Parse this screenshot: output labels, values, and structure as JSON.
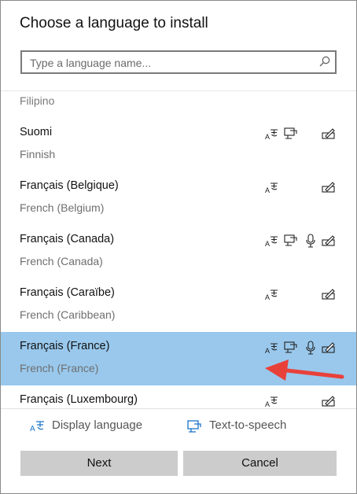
{
  "dialog": {
    "title": "Choose a language to install",
    "search": {
      "placeholder": "Type a language name...",
      "value": ""
    }
  },
  "list": {
    "partial_item": "Filipino",
    "items": [
      {
        "native": "Suomi",
        "english": "Finnish",
        "features": [
          "display-language-icon",
          "text-to-speech-icon",
          "handwriting-icon"
        ],
        "selected": false
      },
      {
        "native": "Français (Belgique)",
        "english": "French (Belgium)",
        "features": [
          "display-language-icon",
          "handwriting-icon"
        ],
        "selected": false
      },
      {
        "native": "Français (Canada)",
        "english": "French (Canada)",
        "features": [
          "display-language-icon",
          "text-to-speech-icon",
          "speech-recognition-icon",
          "handwriting-icon"
        ],
        "selected": false
      },
      {
        "native": "Français (Caraïbe)",
        "english": "French (Caribbean)",
        "features": [
          "display-language-icon",
          "handwriting-icon"
        ],
        "selected": false
      },
      {
        "native": "Français (France)",
        "english": "French (France)",
        "features": [
          "display-language-icon",
          "text-to-speech-icon",
          "speech-recognition-icon",
          "handwriting-icon"
        ],
        "selected": true
      },
      {
        "native": "Français (Luxembourg)",
        "english": "",
        "features": [
          "display-language-icon",
          "handwriting-icon"
        ],
        "selected": false
      }
    ]
  },
  "legend": {
    "display_language": "Display language",
    "text_to_speech": "Text-to-speech"
  },
  "buttons": {
    "next": "Next",
    "cancel": "Cancel"
  },
  "colors": {
    "selected_bg": "#99c8ec",
    "button_bg": "#cccccc",
    "annotation_arrow": "#e8413a",
    "icon_blue": "#1a73c8"
  }
}
